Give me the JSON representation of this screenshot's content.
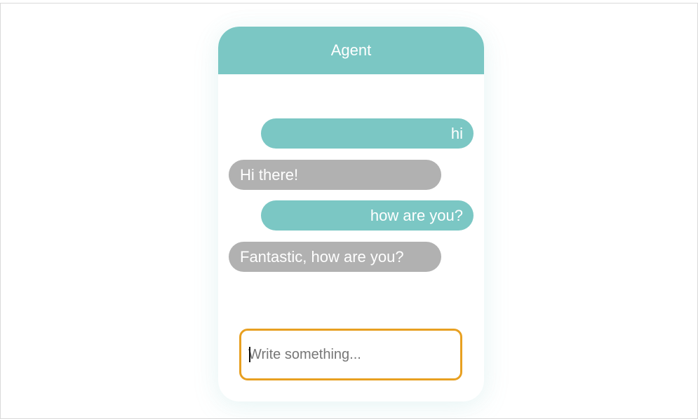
{
  "chat": {
    "title": "Agent",
    "messages": [
      {
        "sender": "user",
        "text": "hi"
      },
      {
        "sender": "agent",
        "text": "Hi there!"
      },
      {
        "sender": "user",
        "text": "how are you?"
      },
      {
        "sender": "agent",
        "text": "Fantastic, how are you?"
      }
    ],
    "input": {
      "value": "",
      "placeholder": "Write something..."
    }
  },
  "colors": {
    "accent": "#7bc7c4",
    "agent_bubble": "#b1b1b1",
    "input_focus_border": "#e8a021",
    "text_on_bubble": "#ffffff"
  }
}
